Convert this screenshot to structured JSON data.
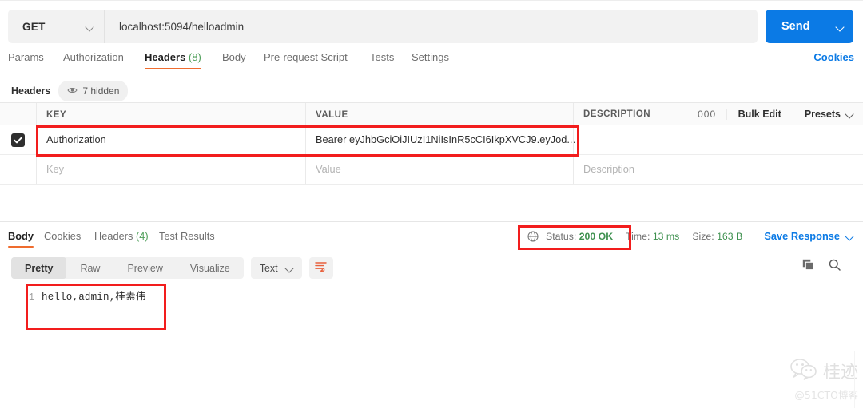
{
  "request": {
    "method": "GET",
    "url": "localhost:5094/helloadmin",
    "send_label": "Send",
    "tabs": [
      {
        "label": "Params",
        "count": "",
        "active": false
      },
      {
        "label": "Authorization",
        "count": "",
        "active": false
      },
      {
        "label": "Headers",
        "count": "(8)",
        "active": true
      },
      {
        "label": "Body",
        "count": "",
        "active": false
      },
      {
        "label": "Pre-request Script",
        "count": "",
        "active": false
      },
      {
        "label": "Tests",
        "count": "",
        "active": false
      },
      {
        "label": "Settings",
        "count": "",
        "active": false
      }
    ],
    "cookies_link": "Cookies",
    "headers_section_label": "Headers",
    "hidden_badge": "7 hidden",
    "eye_icon": "eye-icon"
  },
  "headers_table": {
    "columns": [
      "KEY",
      "VALUE",
      "DESCRIPTION"
    ],
    "actions": {
      "more": "000",
      "bulk_edit": "Bulk Edit",
      "presets": "Presets"
    },
    "rows": [
      {
        "checked": true,
        "key": "Authorization",
        "value": "Bearer eyJhbGciOiJIUzI1NiIsInR5cCI6IkpXVCJ9.eyJod...",
        "description": ""
      }
    ],
    "placeholder_row": {
      "key": "Key",
      "value": "Value",
      "description": "Description"
    }
  },
  "response": {
    "tabs": [
      {
        "label": "Body",
        "count": "",
        "active": true
      },
      {
        "label": "Cookies",
        "count": "",
        "active": false
      },
      {
        "label": "Headers",
        "count": "(4)",
        "active": false
      },
      {
        "label": "Test Results",
        "count": "",
        "active": false
      }
    ],
    "status_icon": "globe-icon",
    "status_label": "Status:",
    "status_value": "200 OK",
    "time_label": "Time:",
    "time_value": "13 ms",
    "size_label": "Size:",
    "size_value": "163 B",
    "save_response": "Save Response",
    "view_modes": [
      {
        "label": "Pretty",
        "active": true
      },
      {
        "label": "Raw",
        "active": false
      },
      {
        "label": "Preview",
        "active": false
      },
      {
        "label": "Visualize",
        "active": false
      }
    ],
    "format": "Text",
    "wrap_icon": "wrap-lines-icon",
    "copy_icon": "copy-icon",
    "search_icon": "search-icon",
    "body_lines": [
      {
        "number": "1",
        "text": "hello,admin,桂素伟"
      }
    ]
  },
  "watermark": {
    "icon": "wechat-icon",
    "name": "桂迹",
    "subtitle": "@51CTO博客"
  },
  "colors": {
    "accent_blue": "#0b7ae5",
    "active_orange": "#ef6c2e",
    "success_green": "#3f9150",
    "annotation_red": "#f21d1d"
  }
}
